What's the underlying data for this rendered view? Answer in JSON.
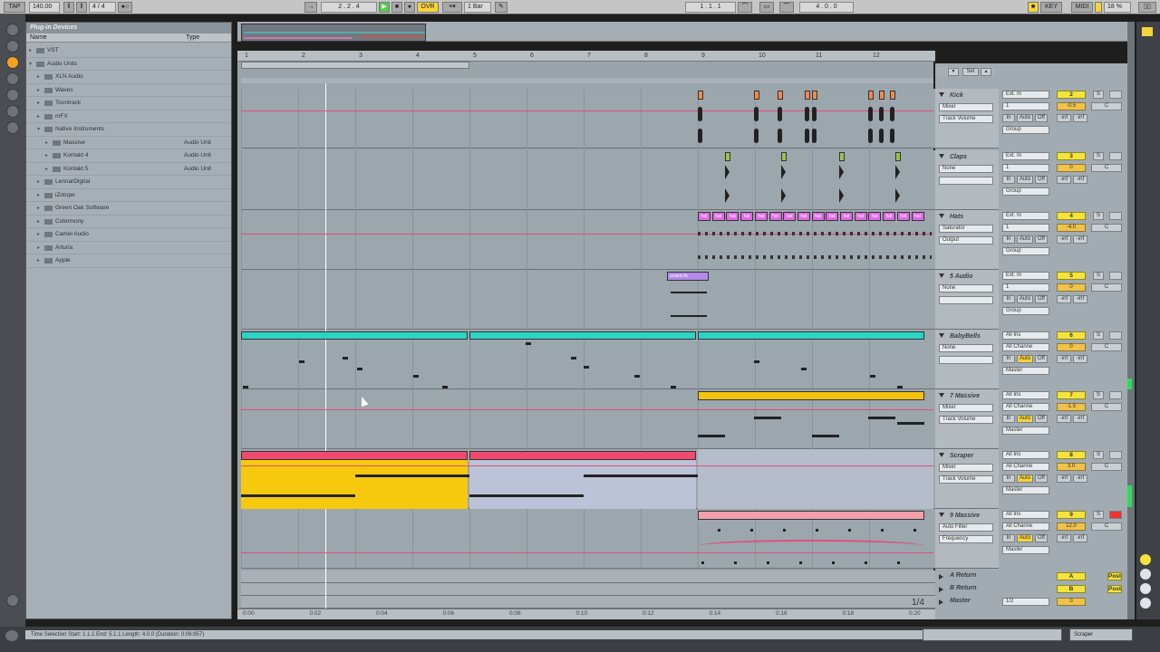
{
  "transport": {
    "tap": "TAP",
    "tempo": "140.00",
    "meter": "4 / 4",
    "loop": "1 Bar",
    "position": "2 . 2 . 4",
    "ovr": "OVR",
    "loop_start": "1 . 1 . 1",
    "loop_length": "4 . 0 . 0",
    "key": "KEY",
    "midi": "MIDI",
    "cpu": "18 %"
  },
  "browser": {
    "title": "Plug-in Devices",
    "col_name": "Name",
    "col_type": "Type",
    "items": [
      {
        "label": "VST",
        "type": ""
      },
      {
        "label": "Audio Units",
        "type": ""
      },
      {
        "label": "XLN Audio",
        "type": ""
      },
      {
        "label": "Waves",
        "type": ""
      },
      {
        "label": "Toontrack",
        "type": ""
      },
      {
        "label": "mFX",
        "type": ""
      },
      {
        "label": "Native Instruments",
        "type": ""
      },
      {
        "label": "Massive",
        "type": "Audio Unit"
      },
      {
        "label": "Kontakt 4",
        "type": "Audio Unit"
      },
      {
        "label": "Kontakt 5",
        "type": "Audio Unit"
      },
      {
        "label": "LennarDigital",
        "type": ""
      },
      {
        "label": "iZotope",
        "type": ""
      },
      {
        "label": "Green Oak Software",
        "type": ""
      },
      {
        "label": "Colormony",
        "type": ""
      },
      {
        "label": "Camel Audio",
        "type": ""
      },
      {
        "label": "Arturia",
        "type": ""
      },
      {
        "label": "Apple",
        "type": ""
      }
    ]
  },
  "ruler": [
    "1",
    "2",
    "3",
    "4",
    "5",
    "6",
    "7",
    "8",
    "9",
    "10",
    "11",
    "12"
  ],
  "time_ruler": [
    "0:00",
    "0:02",
    "0:04",
    "0:06",
    "0:08",
    "0:10",
    "0:12",
    "0:14",
    "0:16",
    "0:18",
    "0:20"
  ],
  "tracks": [
    {
      "name": "Kick",
      "device": "Mixer",
      "param": "Track Volume",
      "input": "Ext. In",
      "chan": "1",
      "num": "2",
      "vol": "-0.5",
      "pan": "C",
      "send_a": "-inf",
      "send_b": "-inf",
      "group": "Group"
    },
    {
      "name": "Claps",
      "device": "None",
      "param": "",
      "input": "Ext. In",
      "chan": "1",
      "num": "3",
      "vol": "0",
      "pan": "C",
      "send_a": "-inf",
      "send_b": "-inf",
      "group": "Group"
    },
    {
      "name": "Hats",
      "device": "Saturator",
      "param": "Output",
      "input": "Ext. In",
      "chan": "1",
      "num": "4",
      "vol": "-4.0",
      "pan": "C",
      "send_a": "-inf",
      "send_b": "-inf",
      "group": "Group"
    },
    {
      "name": "5 Audio",
      "device": "None",
      "param": "",
      "input": "Ext. In",
      "chan": "1",
      "num": "5",
      "vol": "0",
      "pan": "C",
      "send_a": "-inf",
      "send_b": "-inf",
      "group": "Group"
    },
    {
      "name": "BabyBells",
      "device": "None",
      "param": "",
      "input": "All Ins",
      "chan": "All Channe",
      "num": "6",
      "vol": "0",
      "pan": "C",
      "send_a": "-inf",
      "send_b": "-inf",
      "group": "Master"
    },
    {
      "name": "7 Massive",
      "device": "Mixer",
      "param": "Track Volume",
      "input": "All Ins",
      "chan": "All Channe",
      "num": "7",
      "vol": "-1.5",
      "pan": "C",
      "send_a": "-inf",
      "send_b": "-inf",
      "group": "Master"
    },
    {
      "name": "Scraper",
      "device": "Mixer",
      "param": "Track Volume",
      "input": "All Ins",
      "chan": "All Channe",
      "num": "8",
      "vol": "3.0",
      "pan": "C",
      "send_a": "-inf",
      "send_b": "-inf",
      "group": "Master"
    },
    {
      "name": "9 Massive",
      "device": "Auto Filter",
      "param": "Frequency",
      "input": "All Ins",
      "chan": "All Channe",
      "num": "9",
      "vol": "12.0",
      "pan": "C",
      "send_a": "-inf",
      "send_b": "-inf",
      "group": "Master"
    }
  ],
  "clips": {
    "hats_label": "hat",
    "audio_label": "snare-fx"
  },
  "returns": [
    {
      "name": "A Return",
      "letter": "A",
      "post": "Post"
    },
    {
      "name": "B Return",
      "letter": "B",
      "post": "Post"
    },
    {
      "name": "Master",
      "letter": "0",
      "post": "",
      "sel": "1/2"
    }
  ],
  "set_label": "Set",
  "mixer_common": {
    "in": "In",
    "auto": "Auto",
    "off": "Off",
    "sync": "S"
  },
  "page_indicator": "1/4",
  "status": {
    "text": "Time Selection   Start: 1.1.1    End: 5.1.1    Length: 4.0.0  (Duration: 0:06:857)",
    "right_label": "Scraper"
  }
}
